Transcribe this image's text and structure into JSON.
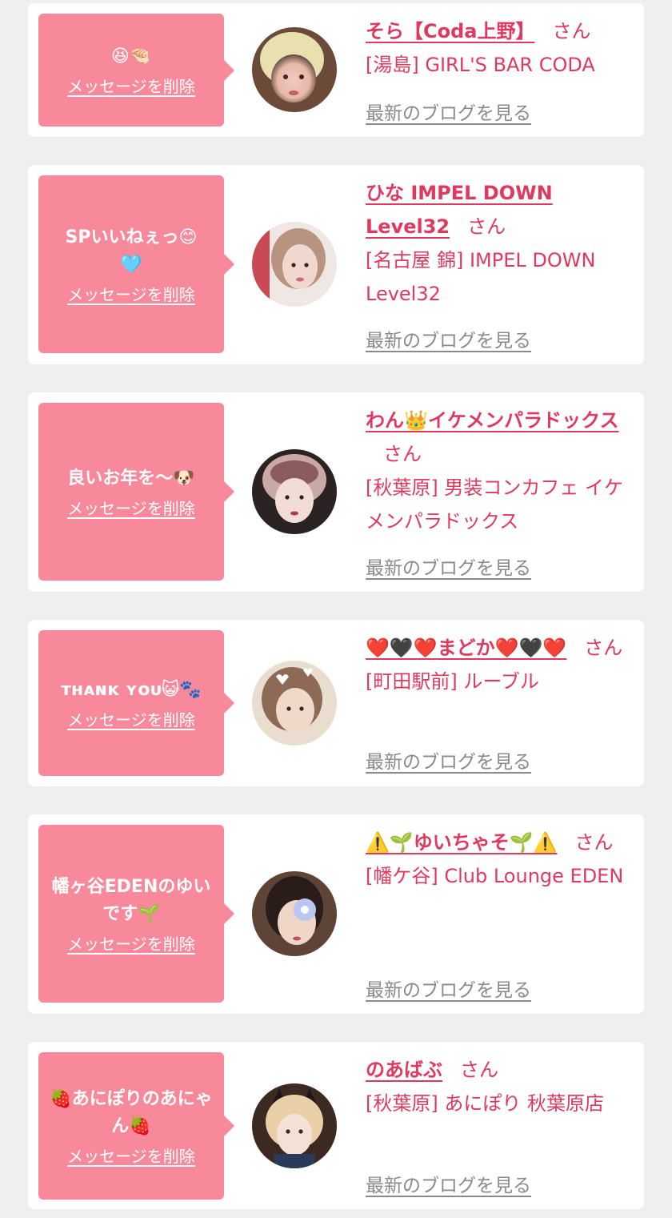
{
  "common": {
    "delete_label": "メッセージを削除",
    "honorific": "さん",
    "blog_label": "最新のブログを見る"
  },
  "colors": {
    "background": "#efefef",
    "card": "#ffffff",
    "bubble": "#f7899b",
    "accent": "#e0395f",
    "muted_link": "#8a8a8a"
  },
  "messages": [
    {
      "bubble_text": "😆🤏🏻",
      "name": "そら【Coda上野】",
      "shop": "[湯島] GIRL'S BAR CODA",
      "avatar_icon": "avatar-photo-blonde"
    },
    {
      "bubble_text": "SPいいねぇっ😊\n🩵",
      "name": "ひな IMPEL DOWN Level32",
      "shop": "[名古屋 錦] IMPEL DOWN Level32",
      "avatar_icon": "avatar-photo-light-brown"
    },
    {
      "bubble_text": "良いお年を〜🐶",
      "name": "わん👑イケメンパラドックス",
      "shop": "[秋葉原] 男装コンカフェ イケメンパラドックス",
      "avatar_icon": "avatar-photo-ash-hair"
    },
    {
      "bubble_text": "ᴛʜᴀɴᴋ ʏᴏᴜ😺🐾",
      "name": "❤️🖤❤️まどか❤️🖤❤️",
      "shop": "[町田駅前] ルーブル",
      "avatar_icon": "avatar-photo-hearts"
    },
    {
      "bubble_text": "幡ヶ谷EDENのゆいです🌱",
      "name": "⚠️🌱ゆいちゃそ🌱⚠️",
      "shop": "[幡ケ谷] Club Lounge EDEN",
      "avatar_icon": "avatar-photo-flower"
    },
    {
      "bubble_text": "🍓あにぽりのあにゃん🍓",
      "name": "のあばぶ",
      "shop": "[秋葉原] あにぽり 秋葉原店",
      "avatar_icon": "avatar-photo-catears"
    }
  ]
}
